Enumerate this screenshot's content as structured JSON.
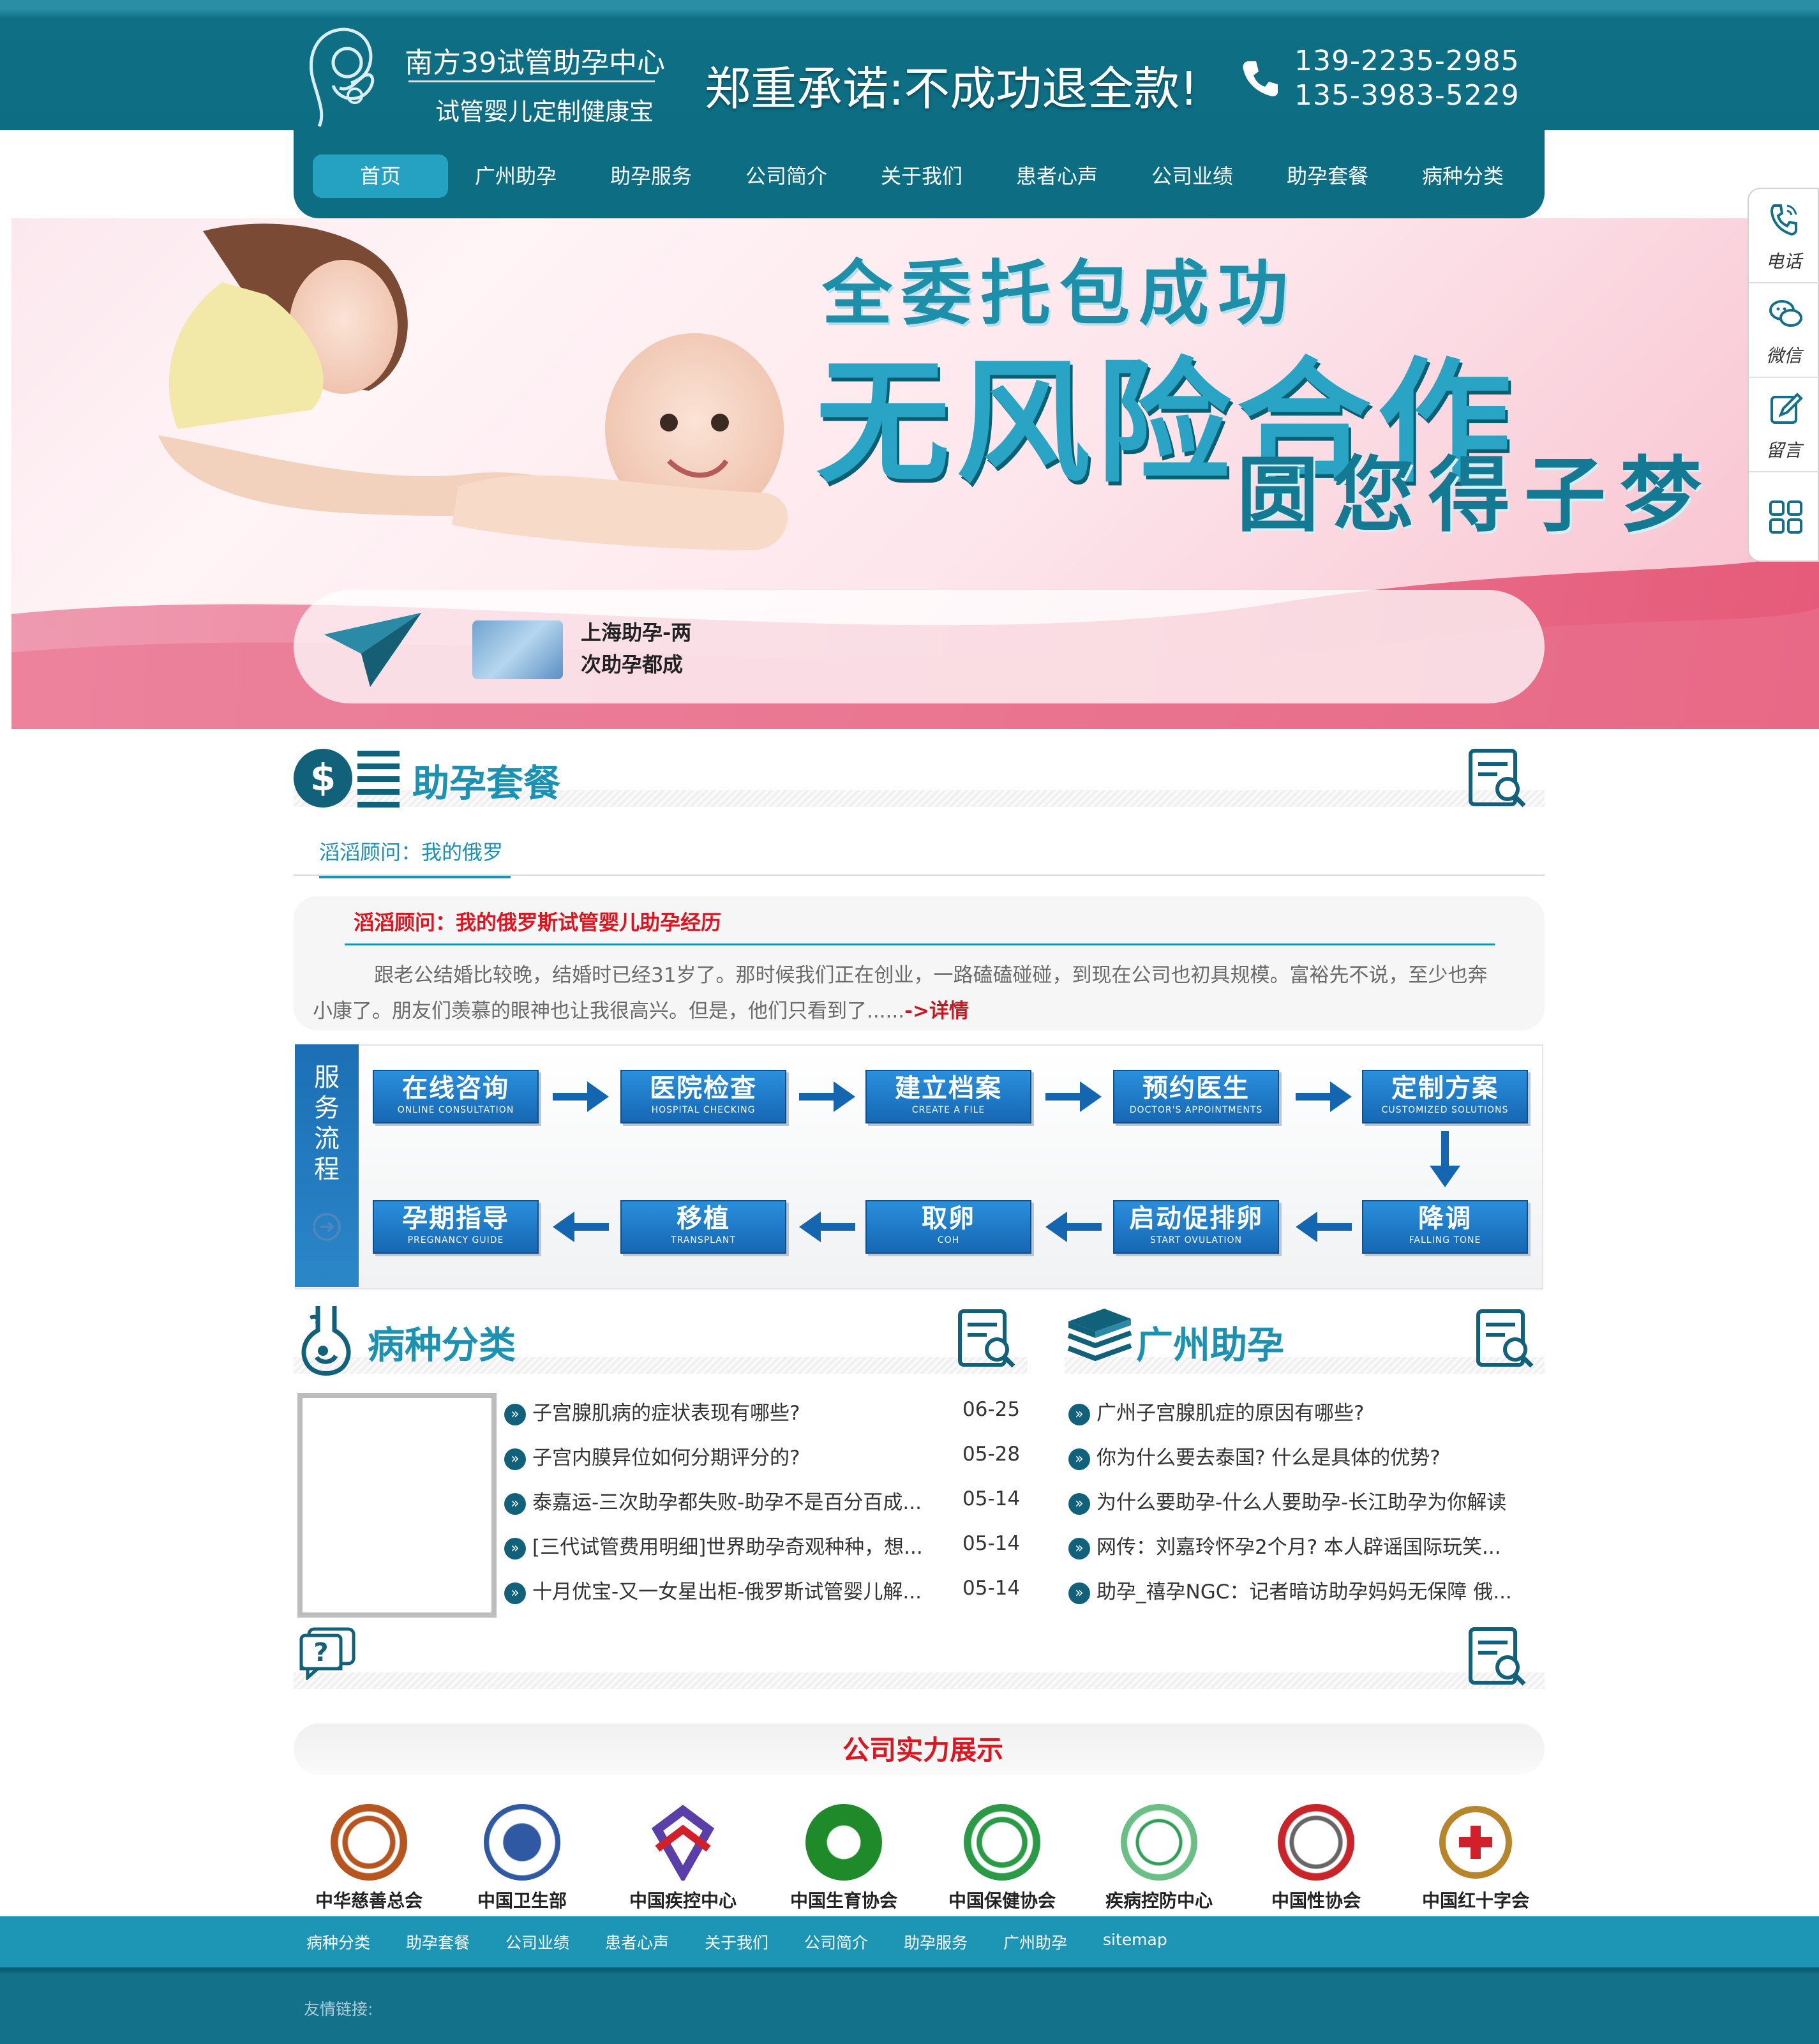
{
  "header": {
    "site_name": "南方39试管助孕中心",
    "tagline": "试管婴儿定制健康宝",
    "slogan": "郑重承诺:不成功退全款!",
    "phone_1": "139-2235-2985",
    "phone_2": "135-3983-5229",
    "brand_color": "#0d6d82"
  },
  "nav": {
    "items": [
      "首页",
      "广州助孕",
      "助孕服务",
      "公司简介",
      "关于我们",
      "患者心声",
      "公司业绩",
      "助孕套餐",
      "病种分类"
    ],
    "active_index": 0
  },
  "banner": {
    "line1": "全委托包成功",
    "line2": "无风险合作",
    "line3": "圆您得子梦"
  },
  "ticker": {
    "line1": "上海助孕-两",
    "line2": "次助孕都成"
  },
  "side_float": {
    "items": [
      {
        "label": "电话",
        "icon": "phone-icon"
      },
      {
        "label": "微信",
        "icon": "wechat-icon"
      },
      {
        "label": "留言",
        "icon": "edit-icon"
      },
      {
        "label": "",
        "icon": "grid-icon"
      }
    ]
  },
  "packages": {
    "title": "助孕套餐",
    "tab": "滔滔顾问：我的俄罗",
    "article_title": "滔滔顾问：我的俄罗斯试管婴儿助孕经历",
    "article_line1": "跟老公结婚比较晚，结婚时已经31岁了。那时候我们正在创业，一路磕磕碰碰，到现在公司也初具规模。富裕先不说，至少也奔",
    "article_line2": "小康了。朋友们羡慕的眼神也让我很高兴。但是，他们只看到了......",
    "more": "->详情"
  },
  "process": {
    "label": "服务流程",
    "row1": [
      {
        "cn": "在线咨询",
        "en": "ONLINE CONSULTATION"
      },
      {
        "cn": "医院检查",
        "en": "HOSPITAL CHECKING"
      },
      {
        "cn": "建立档案",
        "en": "CREATE A FILE"
      },
      {
        "cn": "预约医生",
        "en": "DOCTOR'S APPOINTMENTS"
      },
      {
        "cn": "定制方案",
        "en": "CUSTOMIZED SOLUTIONS"
      }
    ],
    "row2": [
      {
        "cn": "孕期指导",
        "en": "PREGNANCY GUIDE"
      },
      {
        "cn": "移植",
        "en": "TRANSPLANT"
      },
      {
        "cn": "取卵",
        "en": "COH"
      },
      {
        "cn": "启动促排卵",
        "en": "START OVULATION"
      },
      {
        "cn": "降调",
        "en": "FALLING TONE"
      }
    ]
  },
  "diseases": {
    "title": "病种分类",
    "items": [
      {
        "text": "子宫腺肌病的症状表现有哪些?",
        "date": "06-25"
      },
      {
        "text": "子宫内膜异位如何分期评分的?",
        "date": "05-28"
      },
      {
        "text": "泰嘉运-三次助孕都失败-助孕不是百分百成...",
        "date": "05-14"
      },
      {
        "text": "[三代试管费用明细]世界助孕奇观种种，想...",
        "date": "05-14"
      },
      {
        "text": "十月优宝-又一女星出柜-俄罗斯试管婴儿解...",
        "date": "05-14"
      }
    ]
  },
  "guangzhou": {
    "title": "广州助孕",
    "items": [
      "广州子宫腺肌症的原因有哪些?",
      "你为什么要去泰国? 什么是具体的优势?",
      "为什么要助孕-什么人要助孕-长江助孕为你解读",
      "网传：刘嘉玲怀孕2个月? 本人辟谣国际玩笑...",
      "助孕_禧孕NGC：记者暗访助孕妈妈无保障 俄..."
    ]
  },
  "strength": {
    "title": "公司实力展示",
    "orgs": [
      "中华慈善总会",
      "中国卫生部",
      "中国疾控中心",
      "中国生育协会",
      "中国保健协会",
      "疾病控防中心",
      "中国性协会",
      "中国红十字会"
    ]
  },
  "footer": {
    "links": [
      "病种分类",
      "助孕套餐",
      "公司业绩",
      "患者心声",
      "关于我们",
      "公司简介",
      "助孕服务",
      "广州助孕",
      "sitemap"
    ],
    "friend_links": "友情链接:"
  }
}
